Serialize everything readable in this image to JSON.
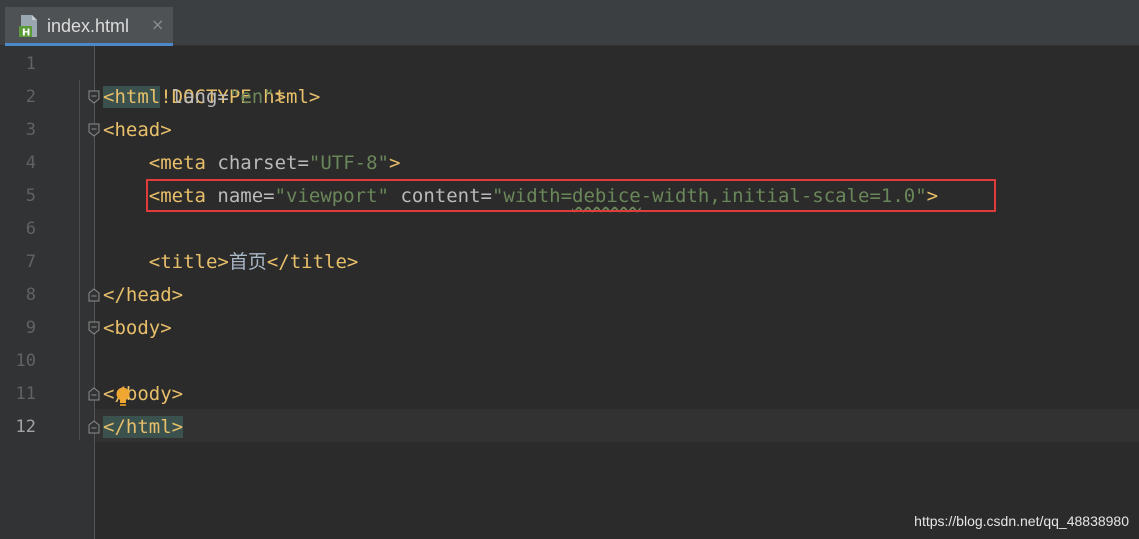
{
  "tab": {
    "title": "index.html",
    "close_glyph": "×",
    "icon": "html-file-icon"
  },
  "gutter": {
    "line_numbers": [
      "1",
      "2",
      "3",
      "4",
      "5",
      "6",
      "7",
      "8",
      "9",
      "10",
      "11",
      "12"
    ],
    "current_line": "12"
  },
  "code": {
    "l1": {
      "p1": "<!DOCTYPE html>"
    },
    "l2": {
      "tag_open": "<html",
      "attr": " lang=",
      "str": "\"en\"",
      "tag_close": ">"
    },
    "l3": {
      "tag": "<head>"
    },
    "l4": {
      "indent": "    ",
      "tag_open": "<meta",
      "attr": " charset=",
      "str": "\"UTF-8\"",
      "tag_close": ">"
    },
    "l5": {
      "indent": "    ",
      "tag_open": "<meta",
      "attr1": " name=",
      "str1": "\"viewport\"",
      "attr2": " content=",
      "str2a": "\"width=",
      "str2b": "debice",
      "str2c": "-width,initial-scale=1.0\"",
      "tag_close": ">"
    },
    "l7": {
      "indent": "    ",
      "tag_open": "<title>",
      "text": "首页",
      "tag_close": "</title>"
    },
    "l8": {
      "tag": "</head>"
    },
    "l9": {
      "tag": "<body>"
    },
    "l11": {
      "tag_a": "<",
      "tag_b": "/body>"
    },
    "l12": {
      "tag": "</html>"
    }
  },
  "colors": {
    "background": "#2b2b2b",
    "gutter": "#313335",
    "tag": "#e8bf6a",
    "attribute": "#bababa",
    "string": "#6a8759",
    "highlight_box": "#e03c3c",
    "tab_underline": "#4a88c7"
  },
  "watermark": "https://blog.csdn.net/qq_48838980"
}
